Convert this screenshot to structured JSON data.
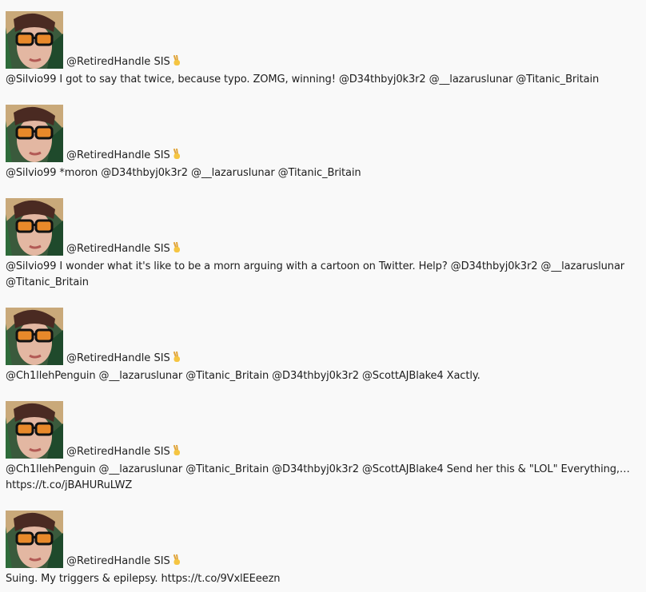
{
  "tweets": [
    {
      "user": "@RetiredHandle SIS",
      "emoji": "victory-hand-icon",
      "text": "@Silvio99 I got to say that twice, because typo. ZOMG, winning! @D34thbyj0k3r2 @__lazaruslunar @Titanic_Britain"
    },
    {
      "user": "@RetiredHandle SIS",
      "emoji": "victory-hand-icon",
      "text": "@Silvio99 *moron @D34thbyj0k3r2 @__lazaruslunar @Titanic_Britain"
    },
    {
      "user": "@RetiredHandle SIS",
      "emoji": "victory-hand-icon",
      "text": "@Silvio99 I wonder what it's like to be a morn arguing with a cartoon on Twitter. Help? @D34thbyj0k3r2 @__lazaruslunar @Titanic_Britain"
    },
    {
      "user": "@RetiredHandle SIS",
      "emoji": "victory-hand-icon",
      "text": "@Ch1llehPenguin @__lazaruslunar @Titanic_Britain @D34thbyj0k3r2 @ScottAJBlake4 Xactly."
    },
    {
      "user": "@RetiredHandle SIS",
      "emoji": "victory-hand-icon",
      "text": "@Ch1llehPenguin @__lazaruslunar @Titanic_Britain @D34thbyj0k3r2 @ScottAJBlake4 Send her this & \"LOL\" Everything,… https://t.co/jBAHURuLWZ"
    },
    {
      "user": "@RetiredHandle SIS",
      "emoji": "victory-hand-icon",
      "text": "Suing. My triggers & epilepsy. https://t.co/9VxlEEeezn"
    }
  ]
}
